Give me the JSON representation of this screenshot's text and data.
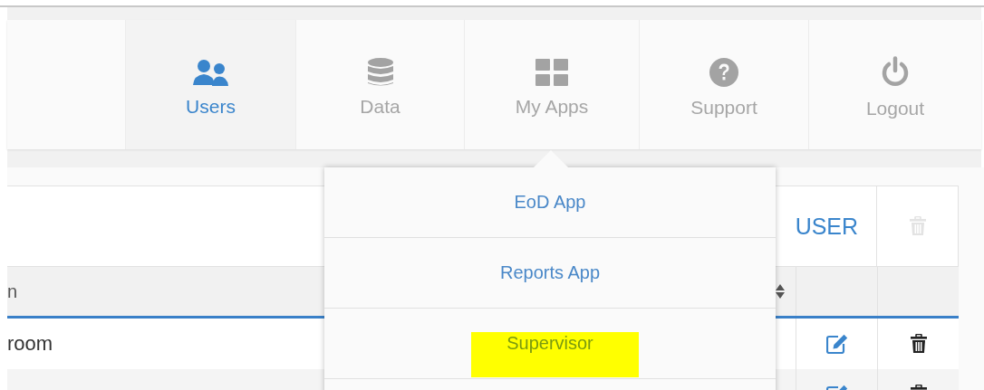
{
  "nav": {
    "items": [
      {
        "label": "Users",
        "kind": "users",
        "selected": true
      },
      {
        "label": "Data",
        "kind": "database",
        "selected": false
      },
      {
        "label": "My Apps",
        "kind": "grid",
        "selected": false
      },
      {
        "label": "Support",
        "kind": "question",
        "selected": false
      },
      {
        "label": "Logout",
        "kind": "power",
        "selected": false
      }
    ]
  },
  "apps_menu": {
    "items": [
      {
        "label": "EoD App",
        "highlighted": false
      },
      {
        "label": "Reports App",
        "highlighted": false
      },
      {
        "label": "Supervisor",
        "highlighted": true
      }
    ]
  },
  "table": {
    "toolbar": {
      "add_button": "USER",
      "delete_disabled": true
    },
    "columns": [
      {
        "label": "n",
        "sortable": true
      }
    ],
    "rows": [
      {
        "column_1": "room"
      },
      {}
    ]
  }
}
